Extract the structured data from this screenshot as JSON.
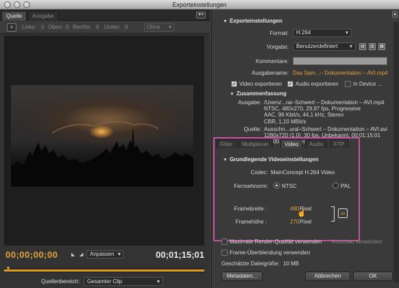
{
  "window": {
    "title": "Exporteinstellungen"
  },
  "left": {
    "tabs": [
      "Quelle",
      "Ausgabe"
    ],
    "panel_menu_icon": "panel-menu-icon",
    "crop": {
      "links_label": "Links:",
      "links_value": "0",
      "oben_label": "Oben:",
      "oben_value": "0",
      "rechts_label": "Rechts:",
      "rechts_value": "0",
      "unten_label": "Unten:",
      "unten_value": "0",
      "ratio_value": "Ohne"
    },
    "timecode_current": "00;00;00;00",
    "timecode_duration": "00;01;15;01",
    "fit_value": "Anpassen",
    "source_range_label": "Quellenbereich:",
    "source_range_value": "Gesamter Clip"
  },
  "right": {
    "export_section": "Exporteinstellungen",
    "format_label": "Format:",
    "format_value": "H.264",
    "preset_label": "Vorgabe:",
    "preset_value": "Benutzerdefiniert",
    "comments_label": "Kommentare:",
    "comments_value": "",
    "output_label": "Ausgabename:",
    "output_value": "Das Sam...– Dokumentation – AVI.mp4",
    "video_export_label": "Video exportieren",
    "audio_export_label": "Audio exportieren",
    "in_device_label": "In Device ...",
    "summary_section": "Zusammenfassung",
    "summary_output_label": "Ausgabe:",
    "summary_output_lines": [
      "/Users/...rai–Schwert – Dokumentation – AVI.mp4",
      "NTSC, 480x270, 29,97 fps, Progressive",
      "AAC, 96 Kbit/s, 44,1 kHz, Stereo",
      "CBR, 1,10 MBit/s"
    ],
    "summary_source_label": "Quelle:",
    "summary_source_lines": [
      "Ausschn...ural–Schwert – Dokumentation – AVI.avi",
      "1280x720 (1,0), 30 fps, Unbekannt, 00;01;15;01",
      "44100 Hz, Stereo"
    ],
    "sub_tabs": [
      "Filter",
      "Multiplexer",
      "Video",
      "Audio",
      "FTP"
    ],
    "video_section": "Grundlegende Videoeinstellungen",
    "codec_label": "Codec:",
    "codec_value": "MainConcept H.264 Video",
    "tv_norm_label": "Fernsehnorm:",
    "ntsc_label": "NTSC",
    "pal_label": "PAL",
    "frame_width_label": "Framebreite :",
    "frame_width_value": "480",
    "frame_width_unit": "Pixel",
    "frame_height_label": "Framehöhe :",
    "frame_height_value": "270",
    "frame_height_unit": "Pixel",
    "max_render_label": "Maximale Render-Qualität verwenden",
    "preview_label": "Vorschau verwenden",
    "frame_blend_label": "Frame-Überblendung verwenden",
    "file_size_label": "Geschätzte Dateigröße:",
    "file_size_value": "10 MB",
    "metadata_button": "Metadaten...",
    "cancel_button": "Abbrechen",
    "ok_button": "OK"
  },
  "colors": {
    "accent": "#e3a33a",
    "highlight": "#c4549d",
    "timeline": "#e39a1d"
  }
}
